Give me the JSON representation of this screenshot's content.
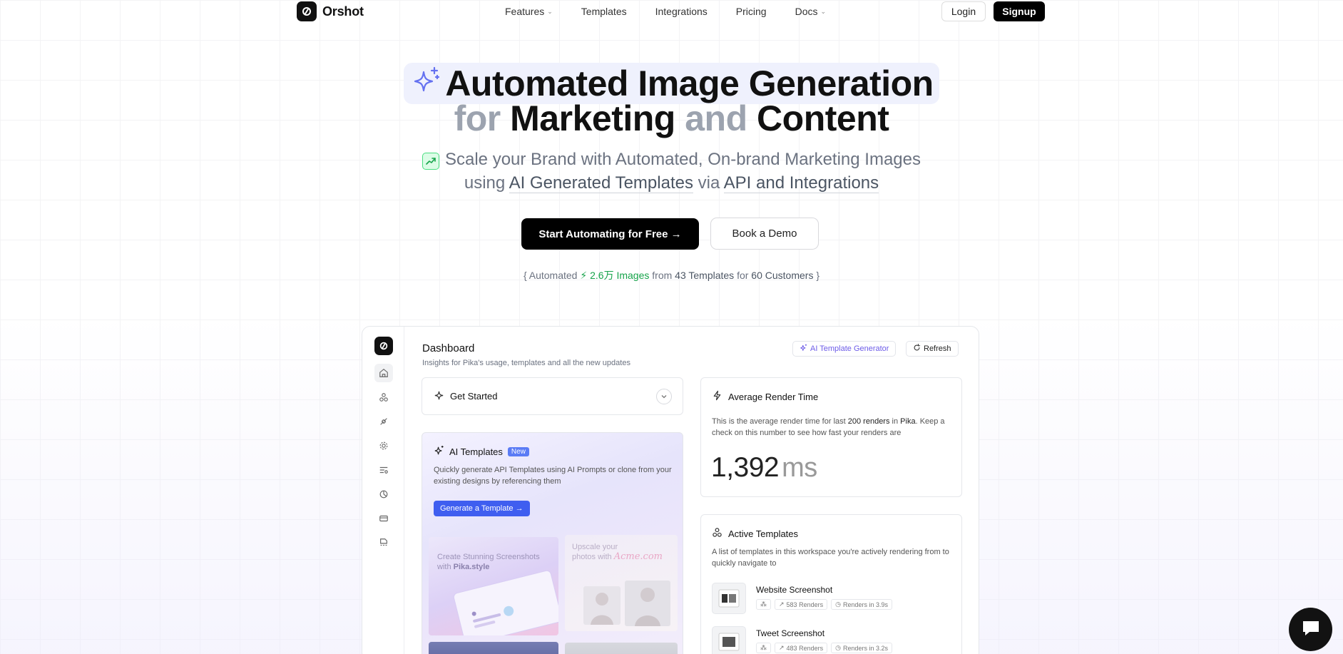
{
  "nav": {
    "brand": "Orshot",
    "links": [
      {
        "label": "Features",
        "has_dropdown": true
      },
      {
        "label": "Templates",
        "has_dropdown": false
      },
      {
        "label": "Integrations",
        "has_dropdown": false
      },
      {
        "label": "Pricing",
        "has_dropdown": false
      },
      {
        "label": "Docs",
        "has_dropdown": true
      }
    ],
    "login_label": "Login",
    "signup_label": "Signup"
  },
  "hero": {
    "title_highlight": "Automated Image Generation",
    "title_for": "for",
    "title_marketing": "Marketing",
    "title_and": "and",
    "title_content": "Content",
    "subtitle_line1": "Scale your Brand with Automated, On-brand Marketing Images",
    "sub_using": "using",
    "sub_ai_templates": "AI Generated Templates",
    "sub_via": "via",
    "sub_api": "API and Integrations",
    "cta_primary": "Start Automating for Free →",
    "cta_secondary": "Book a Demo"
  },
  "stats": {
    "open": "{ Automated",
    "images_count": "2.6万 Images",
    "from": "from",
    "templates": "43 Templates",
    "for": "for",
    "customers": "60 Customers",
    "close": "}"
  },
  "dashboard": {
    "title": "Dashboard",
    "subtitle": "Insights for Pika's usage, templates and all the new updates",
    "ai_generator_label": "AI Template Generator",
    "refresh_label": "Refresh",
    "get_started": "Get Started",
    "ai_templates": {
      "title": "AI Templates",
      "badge": "New",
      "description": "Quickly generate API Templates using AI Prompts or clone from your existing designs by referencing them",
      "button": "Generate a Template →",
      "thumb1_line1": "Create Stunning Screenshots",
      "thumb1_with": "with",
      "thumb1_brand": "Pika.style",
      "thumb2_line1": "Upscale your",
      "thumb2_line2": "photos with",
      "thumb2_brand": "Acme.com"
    },
    "render_time": {
      "title": "Average Render Time",
      "desc_a": "This is the average render time for last",
      "desc_b": "200 renders",
      "desc_c": "in",
      "desc_d": "Pika",
      "desc_e": ". Keep a check on this number to see how fast your renders are",
      "value": "1,392",
      "unit": "ms"
    },
    "active_templates": {
      "title": "Active Templates",
      "description": "A list of templates in this workspace you're actively rendering from to quickly navigate to",
      "items": [
        {
          "name": "Website Screenshot",
          "renders": "583 Renders",
          "speed": "Renders in 3.9s"
        },
        {
          "name": "Tweet Screenshot",
          "renders": "483 Renders",
          "speed": "Renders in 3.2s"
        }
      ]
    }
  },
  "icons": {
    "brand_logo": "orshot-logo-icon",
    "hero_sparkle": "sparkles-icon",
    "trend": "trending-up-icon",
    "chat": "chat-bubble-icon"
  },
  "colors": {
    "primary": "#000000",
    "highlight_bg": "#eff1fd",
    "accent_green": "#16a34a",
    "accent_purple": "#6d5ce8",
    "accent_blue": "#3f5ef0"
  }
}
